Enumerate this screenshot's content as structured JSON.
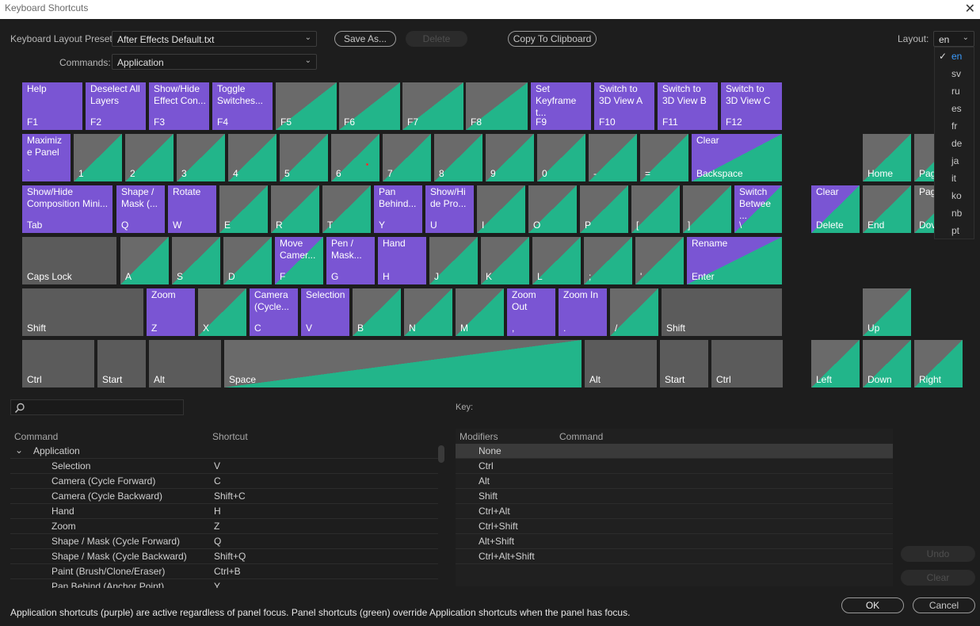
{
  "window": {
    "title": "Keyboard Shortcuts"
  },
  "toolbar": {
    "preset_label": "Keyboard Layout Preset:",
    "preset_value": "After Effects Default.txt",
    "save_as": "Save As...",
    "delete": "Delete",
    "copy": "Copy To Clipboard",
    "commands_label": "Commands:",
    "commands_value": "Application",
    "layout_label": "Layout:",
    "layout_value": "en"
  },
  "layout_menu": {
    "items": [
      "en",
      "sv",
      "ru",
      "es",
      "fr",
      "de",
      "ja",
      "it",
      "ko",
      "nb",
      "pt"
    ],
    "selected": "en"
  },
  "keys": {
    "f1": {
      "label": "Help",
      "name": "F1"
    },
    "f2": {
      "label": "Deselect All Layers",
      "name": "F2"
    },
    "f3": {
      "label": "Show/Hide Effect Con...",
      "name": "F3"
    },
    "f4": {
      "label": "Toggle Switches...",
      "name": "F4"
    },
    "f5": {
      "label": "",
      "name": "F5"
    },
    "f6": {
      "label": "",
      "name": "F6"
    },
    "f7": {
      "label": "",
      "name": "F7"
    },
    "f8": {
      "label": "",
      "name": "F8"
    },
    "f9": {
      "label": "Set Keyframe t...",
      "name": "F9"
    },
    "f10": {
      "label": "Switch to 3D View A",
      "name": "F10"
    },
    "f11": {
      "label": "Switch to 3D View B",
      "name": "F11"
    },
    "f12": {
      "label": "Switch to 3D View C",
      "name": "F12"
    },
    "grave": {
      "label": "Maximiz e Panel",
      "name": "`"
    },
    "n1": {
      "label": "",
      "name": "1"
    },
    "n2": {
      "label": "",
      "name": "2"
    },
    "n3": {
      "label": "",
      "name": "3"
    },
    "n4": {
      "label": "",
      "name": "4"
    },
    "n5": {
      "label": "",
      "name": "5"
    },
    "n6": {
      "label": "",
      "name": "6"
    },
    "n7": {
      "label": "",
      "name": "7"
    },
    "n8": {
      "label": "",
      "name": "8"
    },
    "n9": {
      "label": "",
      "name": "9"
    },
    "n0": {
      "label": "",
      "name": "0"
    },
    "minus": {
      "label": "",
      "name": "-"
    },
    "equal": {
      "label": "",
      "name": "="
    },
    "backspace": {
      "label": "Clear",
      "name": "Backspace"
    },
    "home": {
      "label": "",
      "name": "Home"
    },
    "pageup": {
      "label": "",
      "name": "Pag"
    },
    "tab": {
      "label": "Show/Hide Composition Mini...",
      "name": "Tab"
    },
    "q": {
      "label": "Shape / Mask (...",
      "name": "Q"
    },
    "w": {
      "label": "Rotate",
      "name": "W"
    },
    "e": {
      "label": "",
      "name": "E"
    },
    "r": {
      "label": "",
      "name": "R"
    },
    "t": {
      "label": "",
      "name": "T"
    },
    "y": {
      "label": "Pan Behind...",
      "name": "Y"
    },
    "u": {
      "label": "Show/Hi de Pro...",
      "name": "U"
    },
    "i": {
      "label": "",
      "name": "I"
    },
    "o": {
      "label": "",
      "name": "O"
    },
    "p": {
      "label": "",
      "name": "P"
    },
    "lbracket": {
      "label": "",
      "name": "["
    },
    "rbracket": {
      "label": "",
      "name": "]"
    },
    "backslash": {
      "label": "Switch Betwee ...",
      "name": "\\"
    },
    "delete": {
      "label": "Clear",
      "name": "Delete"
    },
    "end": {
      "label": "",
      "name": "End"
    },
    "pagedown": {
      "label": "Pag",
      "name": "Dov"
    },
    "capslock": {
      "label": "",
      "name": "Caps Lock"
    },
    "a": {
      "label": "",
      "name": "A"
    },
    "s": {
      "label": "",
      "name": "S"
    },
    "d": {
      "label": "",
      "name": "D"
    },
    "f": {
      "label": "Move Camer...",
      "name": "F"
    },
    "g": {
      "label": "Pen / Mask...",
      "name": "G"
    },
    "h": {
      "label": "Hand",
      "name": "H"
    },
    "j": {
      "label": "",
      "name": "J"
    },
    "k": {
      "label": "",
      "name": "K"
    },
    "l": {
      "label": "",
      "name": "L"
    },
    "semicolon": {
      "label": "",
      "name": ";"
    },
    "quote": {
      "label": "",
      "name": "'"
    },
    "enter": {
      "label": "Rename",
      "name": "Enter"
    },
    "lshift": {
      "label": "",
      "name": "Shift"
    },
    "z": {
      "label": "Zoom",
      "name": "Z"
    },
    "x": {
      "label": "",
      "name": "X"
    },
    "c": {
      "label": "Camera (Cycle...",
      "name": "C"
    },
    "v": {
      "label": "Selection",
      "name": "V"
    },
    "b": {
      "label": "",
      "name": "B"
    },
    "nkey": {
      "label": "",
      "name": "N"
    },
    "m": {
      "label": "",
      "name": "M"
    },
    "comma": {
      "label": "Zoom Out",
      "name": ","
    },
    "period": {
      "label": "Zoom In",
      "name": "."
    },
    "slash": {
      "label": "",
      "name": "/"
    },
    "rshift": {
      "label": "",
      "name": "Shift"
    },
    "up": {
      "label": "",
      "name": "Up"
    },
    "lctrl": {
      "label": "",
      "name": "Ctrl"
    },
    "lstart": {
      "label": "",
      "name": "Start"
    },
    "lalt": {
      "label": "",
      "name": "Alt"
    },
    "space": {
      "label": "",
      "name": "Space"
    },
    "ralt": {
      "label": "",
      "name": "Alt"
    },
    "rstart": {
      "label": "",
      "name": "Start"
    },
    "rctrl": {
      "label": "",
      "name": "Ctrl"
    },
    "left": {
      "label": "",
      "name": "Left"
    },
    "down": {
      "label": "",
      "name": "Down"
    },
    "right": {
      "label": "",
      "name": "Right"
    }
  },
  "search": {
    "placeholder": ""
  },
  "key_panel": {
    "label": "Key:"
  },
  "commands_table": {
    "col_command": "Command",
    "col_shortcut": "Shortcut",
    "group": "Application",
    "rows": [
      {
        "command": "Selection",
        "shortcut": "V"
      },
      {
        "command": "Camera (Cycle Forward)",
        "shortcut": "C"
      },
      {
        "command": "Camera (Cycle Backward)",
        "shortcut": "Shift+C"
      },
      {
        "command": "Hand",
        "shortcut": "H"
      },
      {
        "command": "Zoom",
        "shortcut": "Z"
      },
      {
        "command": "Shape / Mask (Cycle Forward)",
        "shortcut": "Q"
      },
      {
        "command": "Shape / Mask (Cycle Backward)",
        "shortcut": "Shift+Q"
      },
      {
        "command": "Paint (Brush/Clone/Eraser)",
        "shortcut": "Ctrl+B"
      },
      {
        "command": "Pan Behind (Anchor Point)",
        "shortcut": "Y"
      }
    ]
  },
  "modifiers_table": {
    "col_modifiers": "Modifiers",
    "col_command": "Command",
    "rows": [
      "None",
      "Ctrl",
      "Alt",
      "Shift",
      "Ctrl+Alt",
      "Ctrl+Shift",
      "Alt+Shift",
      "Ctrl+Alt+Shift"
    ]
  },
  "side_buttons": {
    "undo": "Undo",
    "clear": "Clear"
  },
  "footer": {
    "note": "Application shortcuts (purple) are active regardless of panel focus. Panel shortcuts (green) override Application shortcuts when the panel has focus.",
    "ok": "OK",
    "cancel": "Cancel"
  },
  "colors": {
    "purple": "#7a55d3",
    "green": "#22b58a",
    "grey": "#5b5b5b"
  }
}
